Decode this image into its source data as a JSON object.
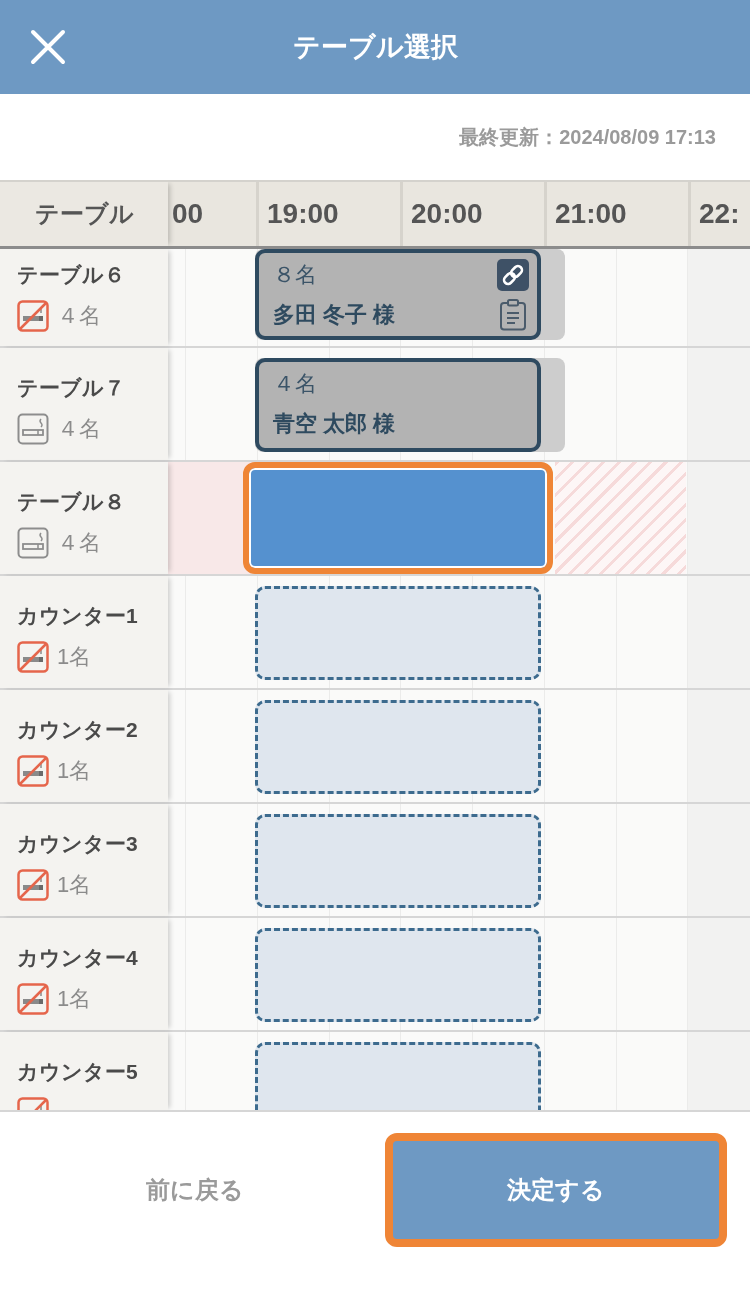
{
  "header": {
    "title": "テーブル選択"
  },
  "last_updated": "最終更新：2024/08/09 17:13",
  "timeline": {
    "corner_label": "テーブル",
    "hours": [
      "00",
      "19:00",
      "20:00",
      "21:00",
      "22:"
    ]
  },
  "tables": [
    {
      "name": "テーブル６",
      "smoking": false,
      "capacity": "４名",
      "blocked": false,
      "booking": {
        "kind": "reservation",
        "party": "８名",
        "guest": "多田 冬子 様",
        "linked": true,
        "memo": true
      }
    },
    {
      "name": "テーブル７",
      "smoking": true,
      "capacity": "４名",
      "blocked": false,
      "booking": {
        "kind": "reservation",
        "party": "４名",
        "guest": "青空 太郎 様",
        "linked": false,
        "memo": false
      }
    },
    {
      "name": "テーブル８",
      "smoking": true,
      "capacity": "４名",
      "blocked": true,
      "booking": {
        "kind": "slot",
        "selected": true
      }
    },
    {
      "name": "カウンター1",
      "smoking": false,
      "capacity": "1名",
      "blocked": false,
      "booking": {
        "kind": "slot",
        "selected": false
      }
    },
    {
      "name": "カウンター2",
      "smoking": false,
      "capacity": "1名",
      "blocked": false,
      "booking": {
        "kind": "slot",
        "selected": false
      }
    },
    {
      "name": "カウンター3",
      "smoking": false,
      "capacity": "1名",
      "blocked": false,
      "booking": {
        "kind": "slot",
        "selected": false
      }
    },
    {
      "name": "カウンター4",
      "smoking": false,
      "capacity": "1名",
      "blocked": false,
      "booking": {
        "kind": "slot",
        "selected": false
      }
    },
    {
      "name": "カウンター5",
      "smoking": false,
      "blocked": false,
      "booking": {
        "kind": "slot",
        "selected": false
      }
    }
  ],
  "footer_buttons": [
    {
      "label": "前に戻る",
      "kind": "secondary",
      "highlighted": false
    },
    {
      "label": "決定する",
      "kind": "primary",
      "highlighted": true
    }
  ]
}
